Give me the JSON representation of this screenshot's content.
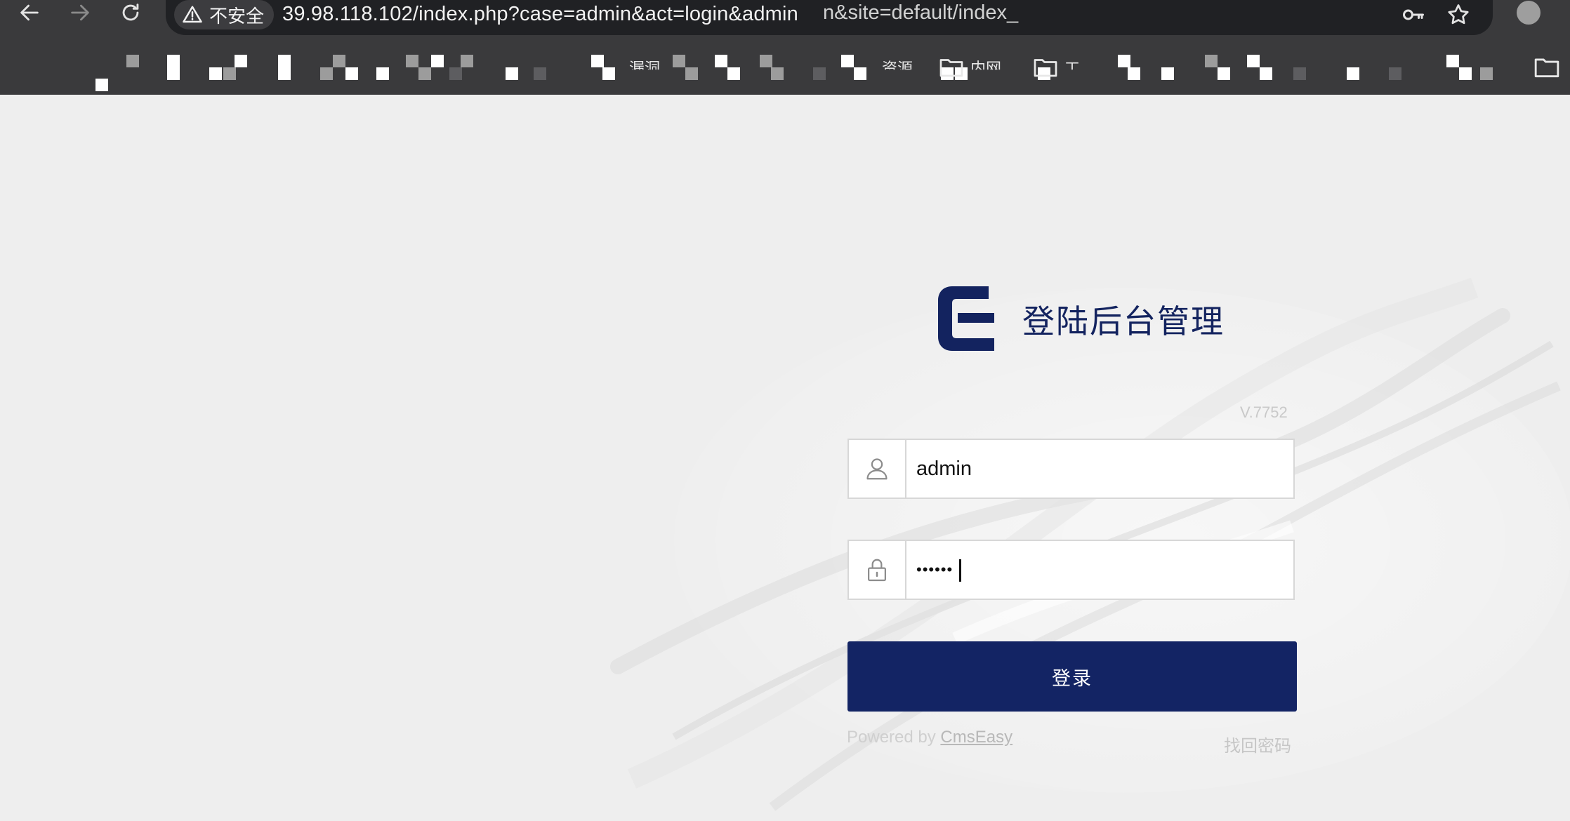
{
  "browser": {
    "security_label": "不安全",
    "url": "39.98.118.102/index.php?case=admin&act=login&admin",
    "url_tail": "n&site=default/index_",
    "icons": {
      "back": "back-arrow-icon",
      "forward": "forward-arrow-icon",
      "reload": "reload-icon",
      "warning": "warning-triangle-icon",
      "key": "key-icon",
      "bookmark": "star-icon",
      "folder": "folder-icon"
    },
    "bookmarks": [
      {
        "label": "漏洞"
      },
      {
        "label": "资源"
      },
      {
        "label": "内网"
      },
      {
        "label": "工"
      }
    ]
  },
  "login": {
    "title": "登陆后台管理",
    "version": "V.7752",
    "username_value": "admin",
    "password_value": "••••••",
    "submit_label": "登录",
    "powered_prefix": "Powered by ",
    "powered_link": "CmsEasy",
    "forgot_label": "找回密码"
  },
  "colors": {
    "brand": "#132464",
    "chrome_bg": "#3a3a3c",
    "page_bg": "#eeeeee"
  }
}
